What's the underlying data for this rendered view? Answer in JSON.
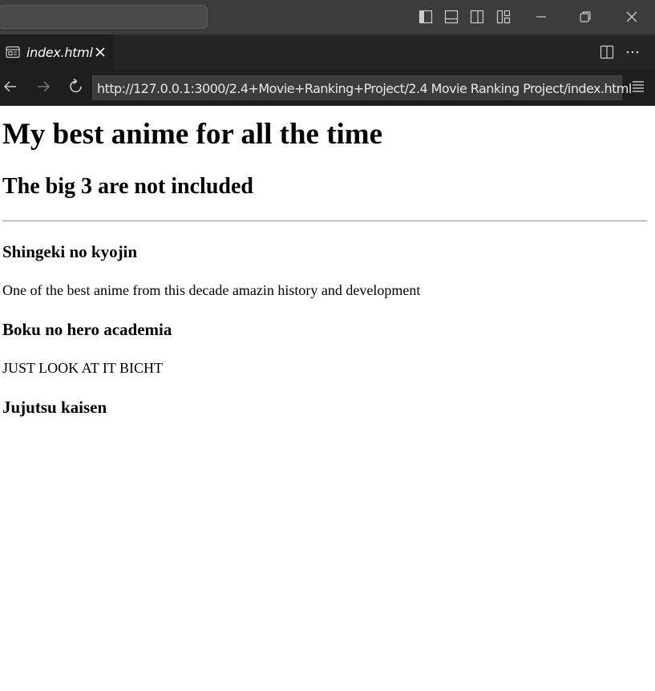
{
  "browser": {
    "tab": {
      "label": "index.html"
    },
    "url": "http://127.0.0.1:3000/2.4+Movie+Ranking+Project/2.4 Movie Ranking Project/index.html"
  },
  "page": {
    "title": "My best anime for all the time",
    "subtitle": "The big 3 are not included",
    "entries": [
      {
        "name": "Shingeki no kyojin",
        "description": "One of the best anime from this decade amazin history and development"
      },
      {
        "name": "Boku no hero academia",
        "description": "JUST LOOK AT IT BICHT"
      },
      {
        "name": "Jujutsu kaisen"
      }
    ]
  },
  "colors": {
    "titlebar": "#3c3c3c",
    "tabbar": "#252526",
    "editor_bg": "#1e1e1e",
    "page_bg": "#ffffff"
  }
}
